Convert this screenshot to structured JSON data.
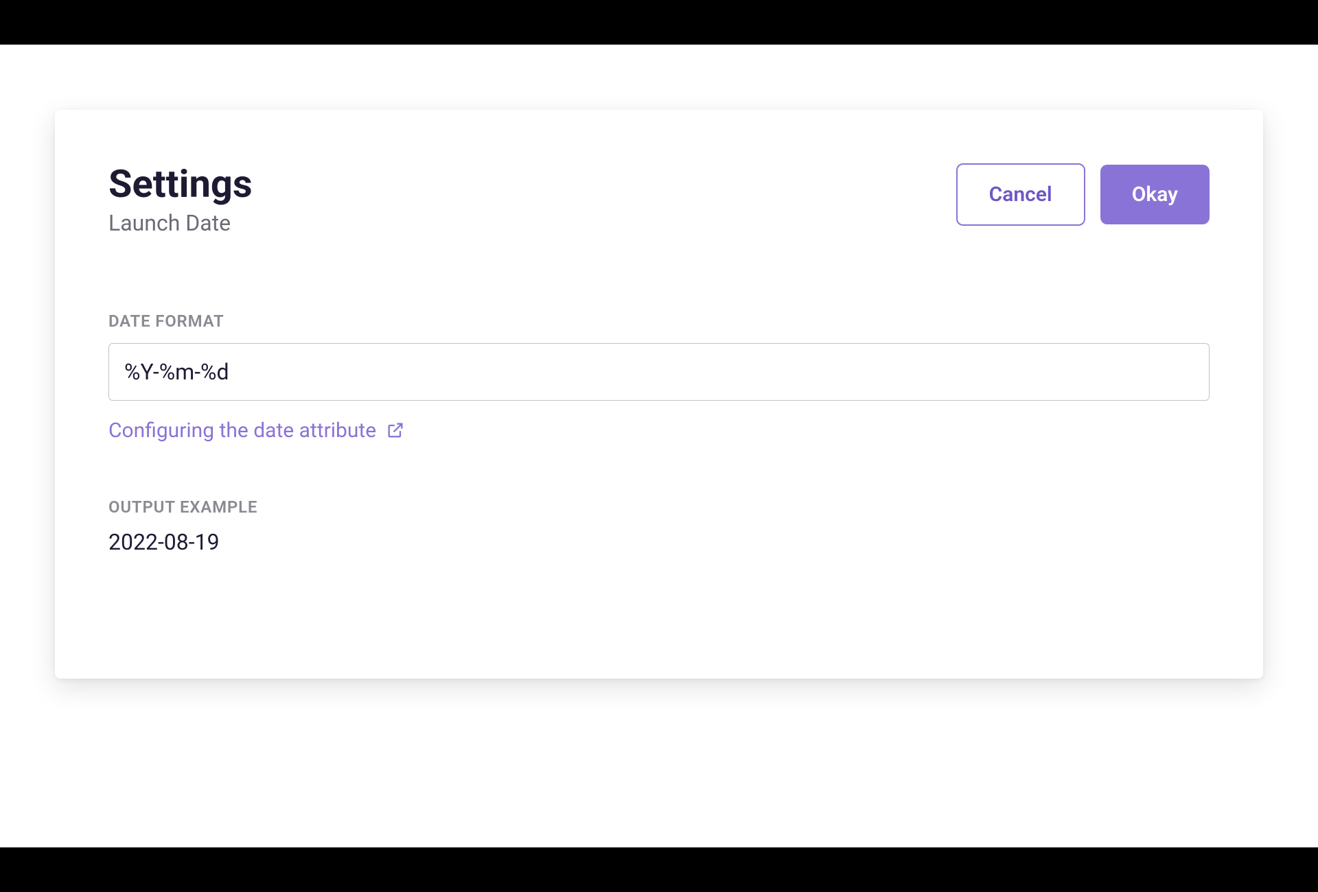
{
  "header": {
    "title": "Settings",
    "subtitle": "Launch Date",
    "cancel_label": "Cancel",
    "okay_label": "Okay"
  },
  "date_format": {
    "label": "DATE FORMAT",
    "value": "%Y-%m-%d",
    "help_link_text": "Configuring the date attribute"
  },
  "output_example": {
    "label": "OUTPUT EXAMPLE",
    "value": "2022-08-19"
  }
}
